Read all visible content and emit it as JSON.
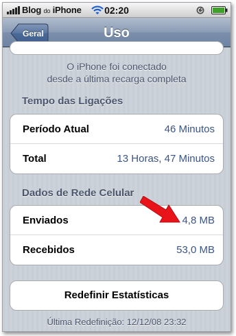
{
  "status_bar": {
    "carrier": "Blog",
    "carrier_small": "do",
    "carrier_suffix": "iPhone",
    "time": "02:20"
  },
  "nav": {
    "back_label": "Geral",
    "title": "Uso"
  },
  "info_text": {
    "line1": "O iPhone foi conectado",
    "line2": "desde a última recarga completa"
  },
  "call_time": {
    "header": "Tempo das Ligações",
    "rows": [
      {
        "label": "Período Atual",
        "value": "46 Minutos"
      },
      {
        "label": "Total",
        "value": "13 Horas, 47 Minutos"
      }
    ]
  },
  "cellular_data": {
    "header": "Dados de Rede Celular",
    "rows": [
      {
        "label": "Enviados",
        "value": "4,8 MB"
      },
      {
        "label": "Recebidos",
        "value": "53,0 MB"
      }
    ]
  },
  "reset": {
    "button_label": "Redefinir Estatísticas",
    "last_reset": "Última Redefinição: 12/12/08 23:32"
  },
  "colors": {
    "nav_bar": "#7c8fab",
    "value_text": "#3a5485",
    "section_text": "#4c566c",
    "annotation_arrow": "#e8141a"
  },
  "icons": [
    "signal-icon",
    "wifi-icon",
    "lock-icon",
    "battery-icon",
    "back-arrow-icon",
    "annotation-arrow-icon"
  ]
}
